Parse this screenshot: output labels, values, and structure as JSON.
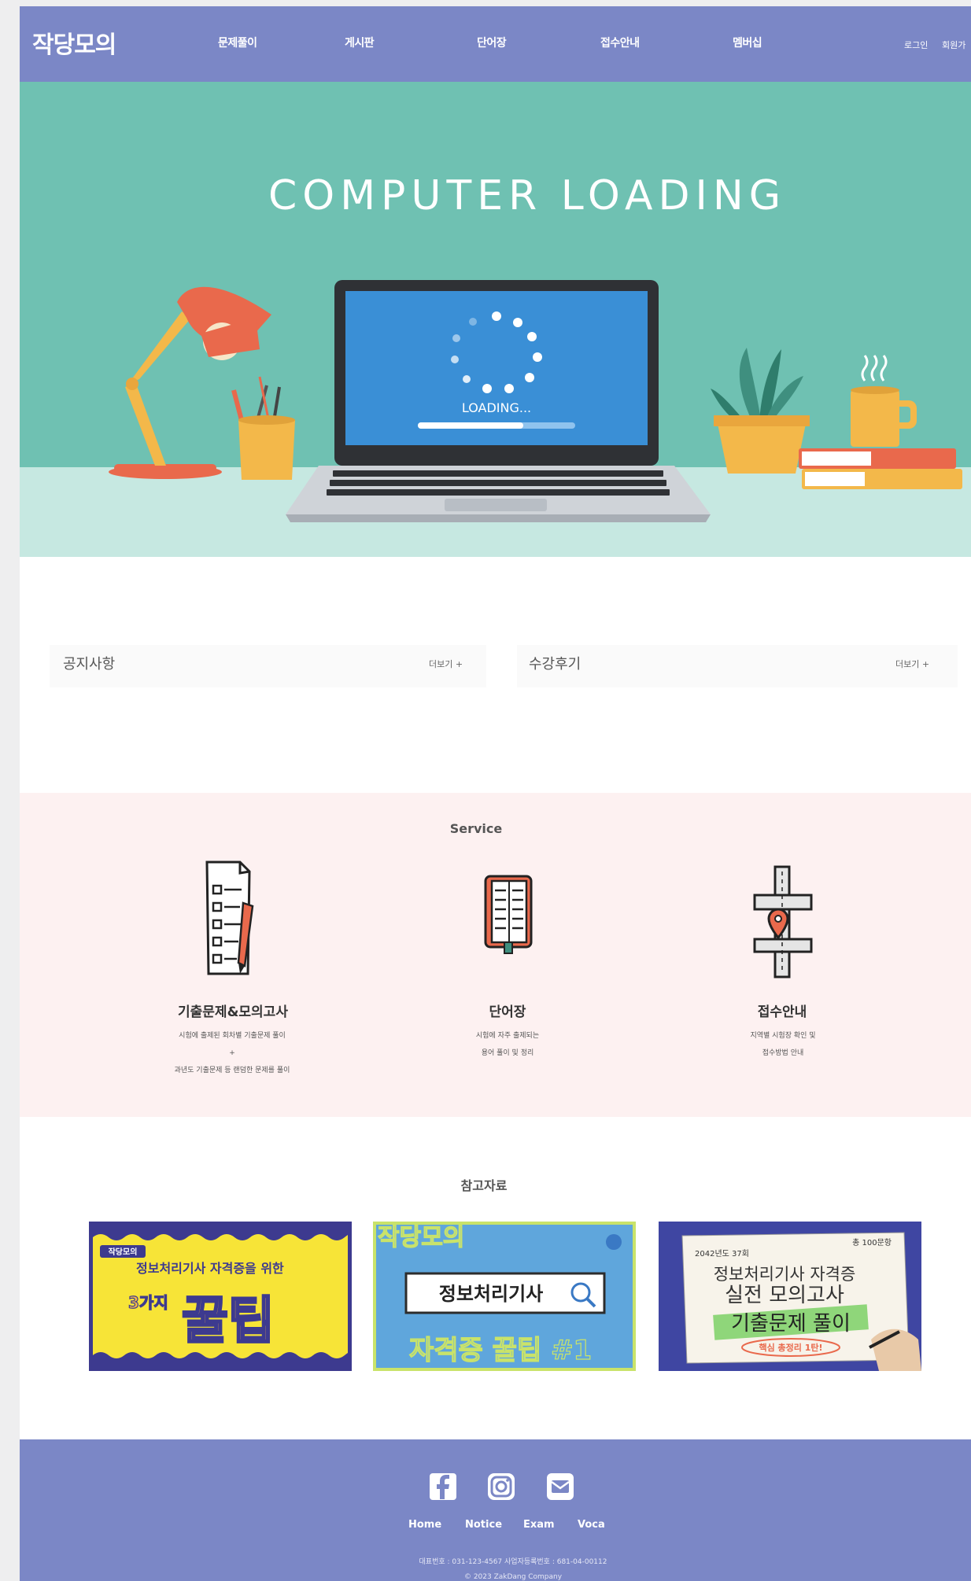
{
  "header": {
    "logo": "작당모의",
    "nav": [
      "문제풀이",
      "게시판",
      "단어장",
      "접수안내",
      "멤버십"
    ],
    "login": "로그인",
    "signup": "회원가"
  },
  "hero": {
    "title": "COMPUTER LOADING",
    "loading_text": "LOADING..."
  },
  "boards": {
    "notice_title": "공지사항",
    "notice_more": "더보기 +",
    "review_title": "수강후기",
    "review_more": "더보기 +"
  },
  "service": {
    "title": "Service",
    "items": [
      {
        "icon": "exam-paper-icon",
        "name": "기출문제&모의고사",
        "desc1": "시험에 출제된 회차별 기출문제 풀이",
        "desc2": "+",
        "desc3": "과년도 기출문제 등 랜덤한 문제를 풀이"
      },
      {
        "icon": "vocabulary-book-icon",
        "name": "단어장",
        "desc1": "시험에 자주 출제되는",
        "desc2": "용어 풀이 및 정리",
        "desc3": ""
      },
      {
        "icon": "map-pin-icon",
        "name": "접수안내",
        "desc1": "지역별 시험장 확인 및",
        "desc2": "접수방법 안내",
        "desc3": ""
      }
    ]
  },
  "references": {
    "title": "참고자료",
    "cards": [
      {
        "badge": "작당모의",
        "subtitle": "정보처리기사 자격증을 위한",
        "count": "3가지",
        "main": "꿀팁"
      },
      {
        "top": "작당모의",
        "main": "정보처리기사",
        "bottom": "자격증 꿀팁 #1"
      },
      {
        "year": "2042년도 37회",
        "total": "총 100문항",
        "line1": "정보처리기사 자격증",
        "line2": "실전 모의고사",
        "line3": "기출문제 풀이",
        "tag": "핵심 총정리 1탄!"
      }
    ]
  },
  "footer": {
    "links": [
      "Home",
      "Notice",
      "Exam",
      "Voca"
    ],
    "phone": "대표번호 : 031-123-4567   사업자등록번호 : 681-04-00112",
    "copyright": "© 2023 ZakDang Company"
  },
  "colors": {
    "header": "#7b87c6",
    "hero": "#6fc1b2",
    "service_bg": "#fdf1f1",
    "footer": "#7b87c6"
  }
}
